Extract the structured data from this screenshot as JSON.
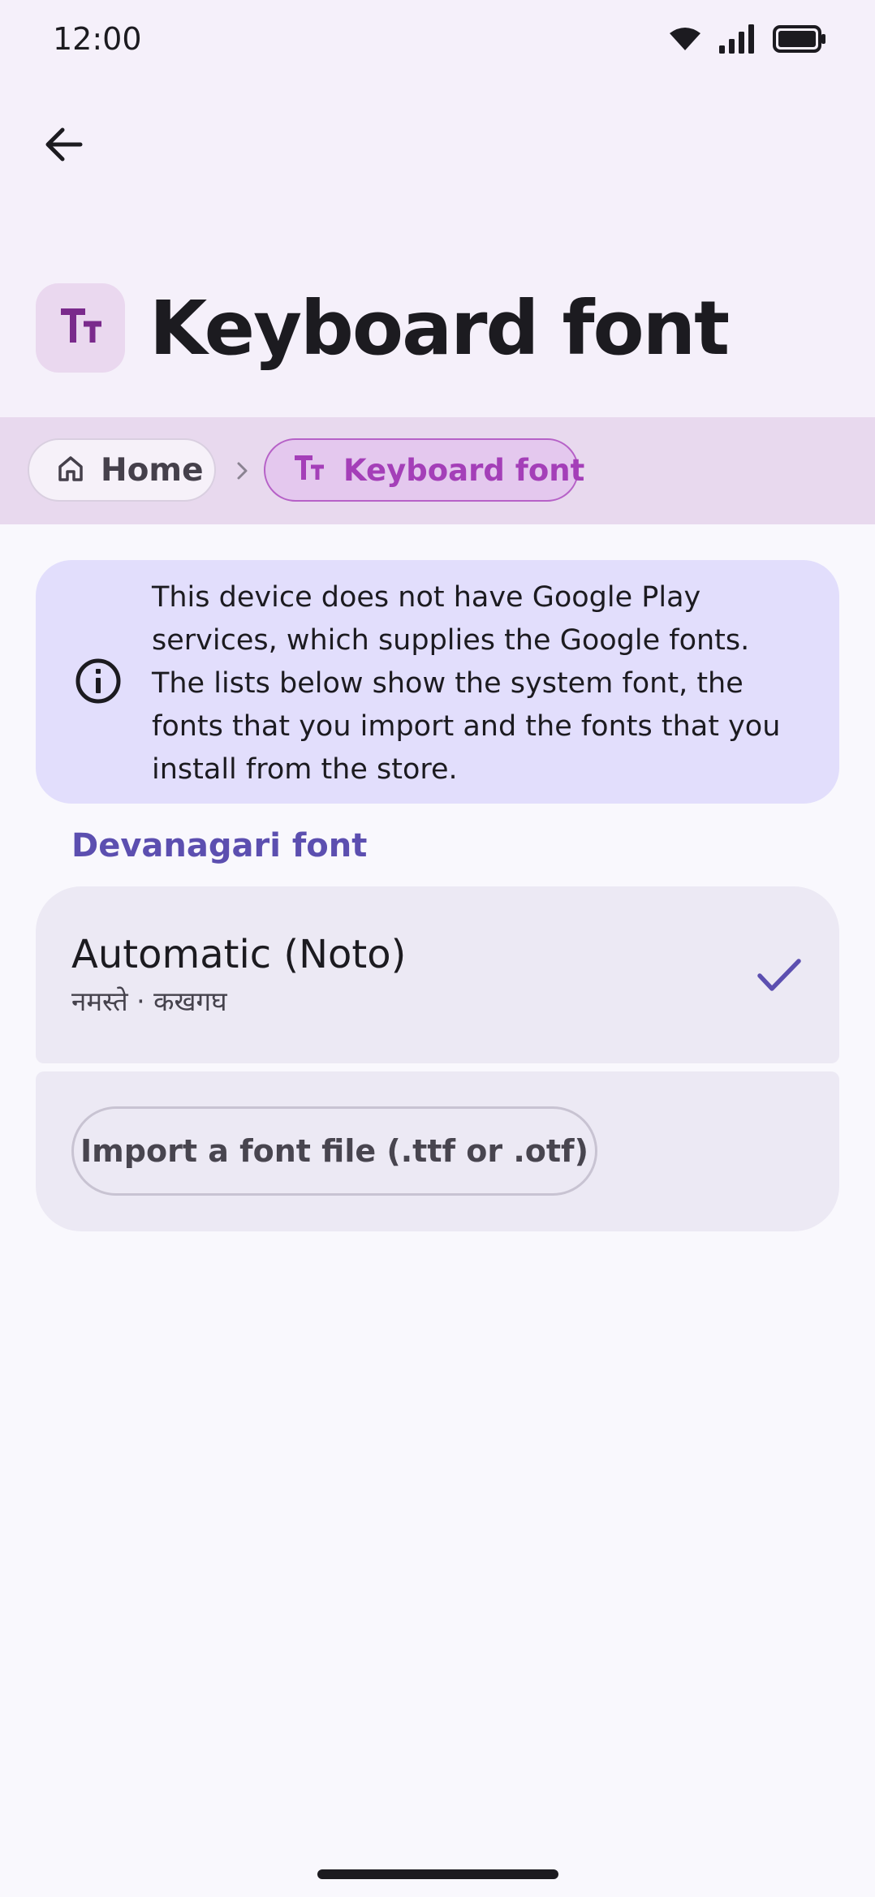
{
  "status_bar": {
    "time": "12:00",
    "icons": [
      "wifi-icon",
      "signal-icon",
      "battery-icon"
    ]
  },
  "header": {
    "back_icon": "arrow-back-icon",
    "title_icon": "text-fields-icon",
    "title": "Keyboard font"
  },
  "breadcrumb": {
    "items": [
      {
        "label": "Home",
        "icon": "home-icon"
      },
      {
        "label": "Keyboard font",
        "icon": "text-fields-icon"
      }
    ],
    "separator_icon": "chevron-right-icon"
  },
  "info_card": {
    "icon": "info-icon",
    "text": "This device does not have Google Play services, which supplies the Google fonts. The lists below show the system font, the fonts that you import and the fonts that you install from the store."
  },
  "section": {
    "header": "Devanagari font"
  },
  "font_options": [
    {
      "title": "Automatic (Noto)",
      "sample": "नमस्ते · कखगघ",
      "selected": true,
      "selected_icon": "check-icon"
    }
  ],
  "import": {
    "button_label": "Import a font file (.ttf or .otf)"
  },
  "colors": {
    "accent": "#a43fb8",
    "section_header": "#5c4fb0",
    "info_background": "#e2defc",
    "card_background": "#ece9f4"
  }
}
